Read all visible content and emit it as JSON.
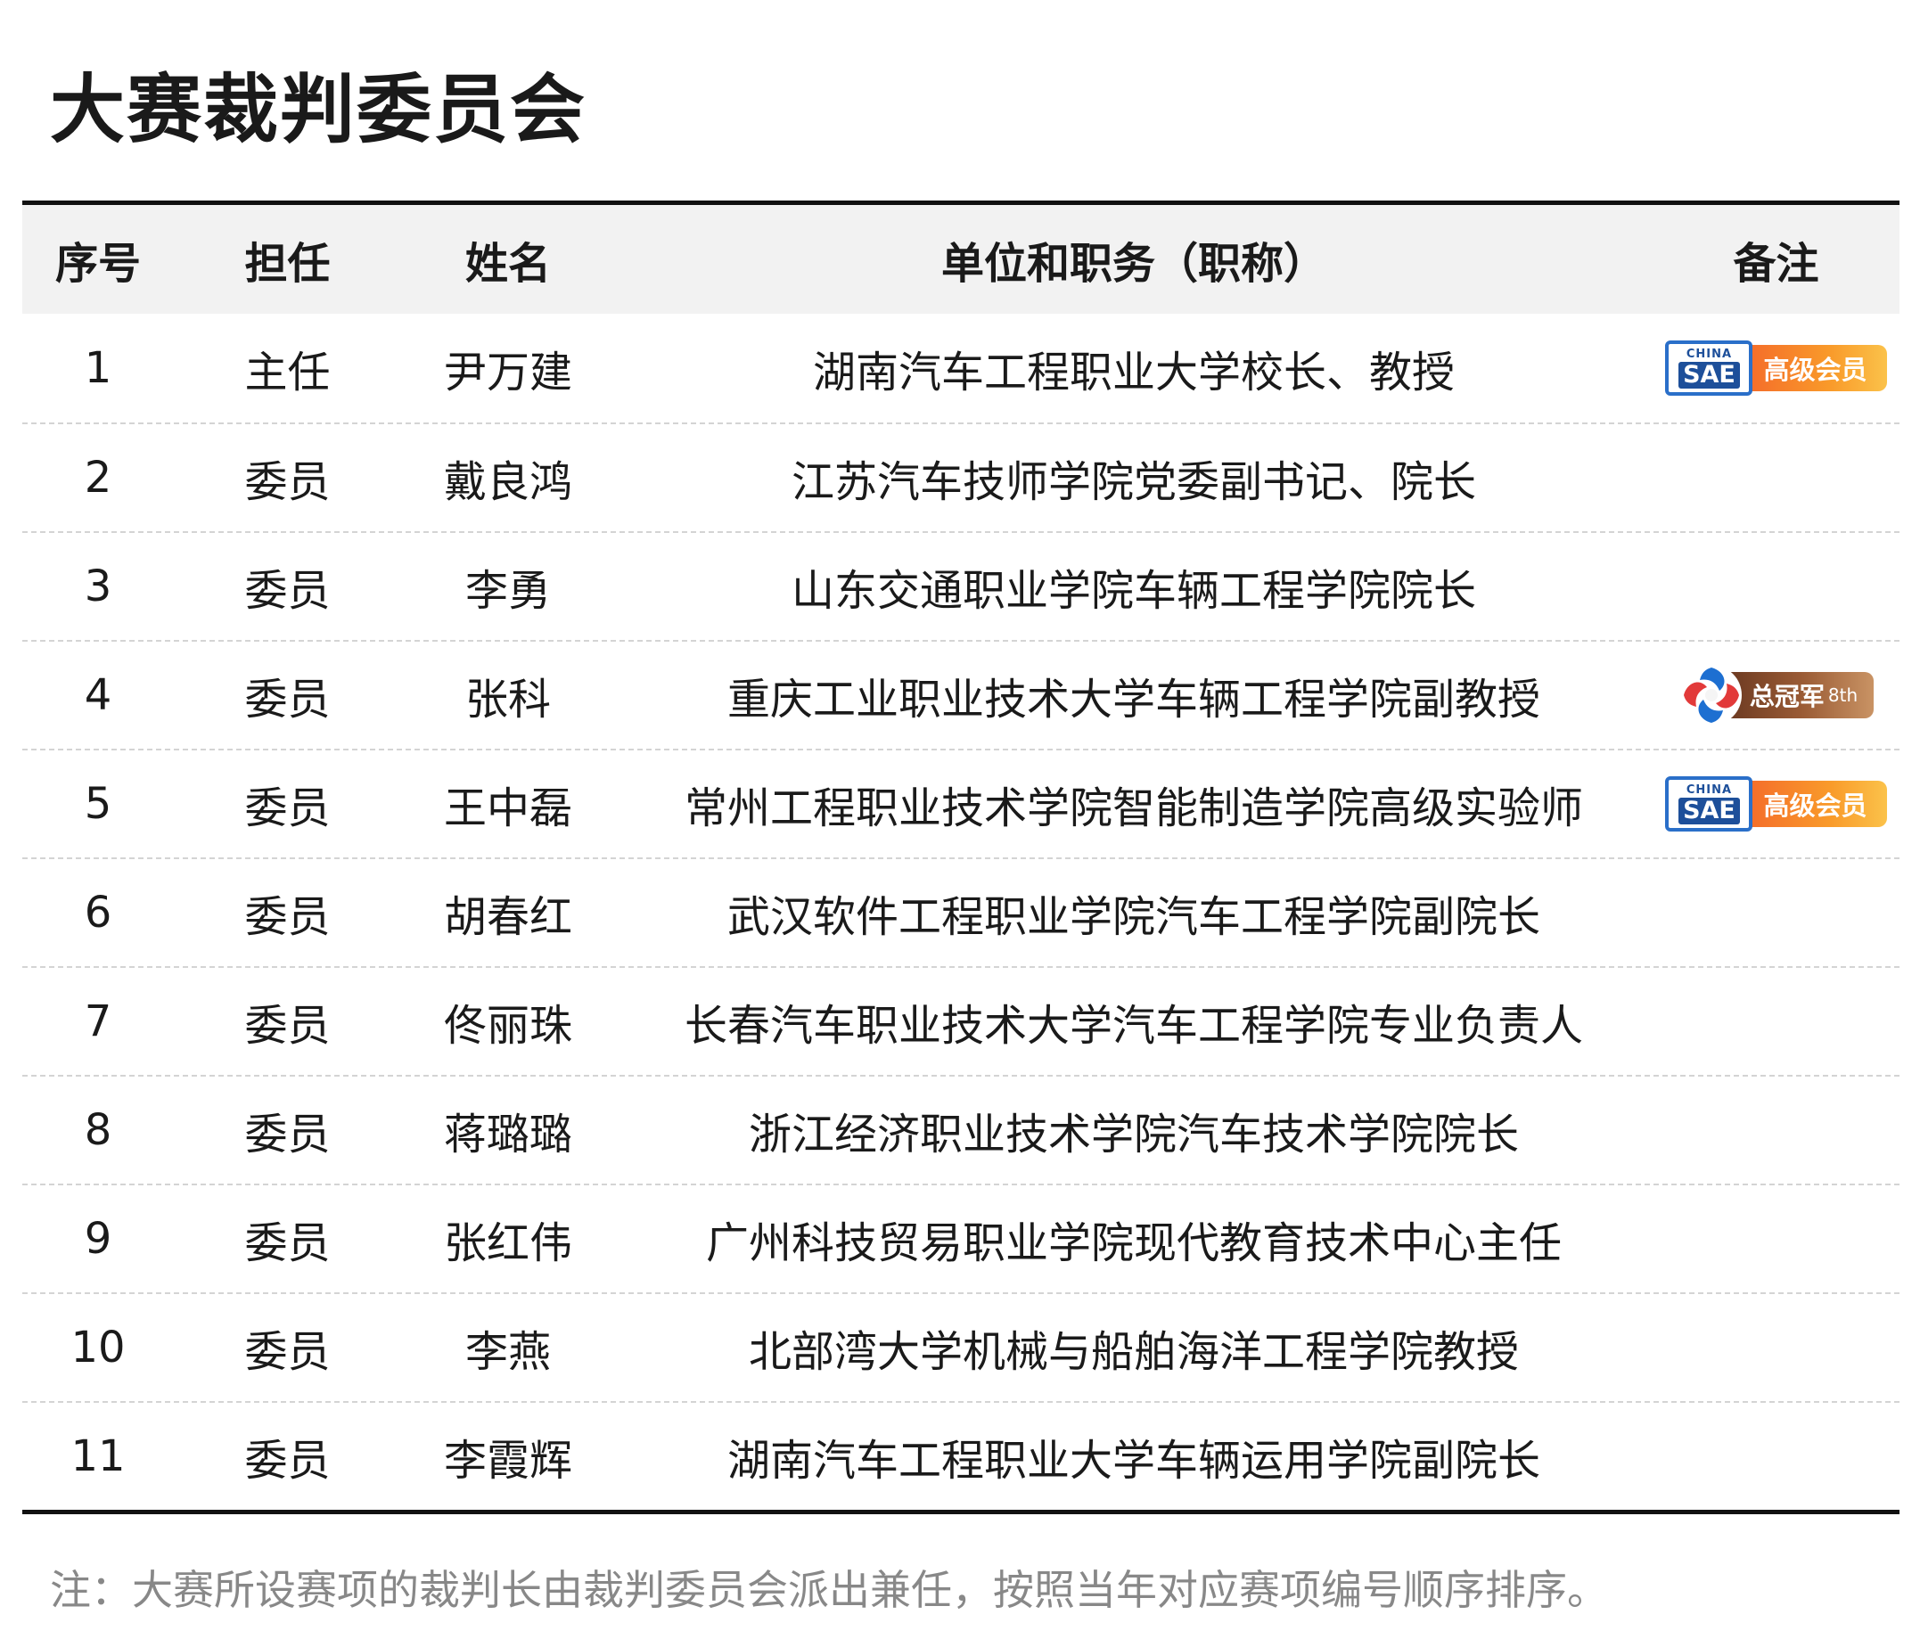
{
  "title": "大赛裁判委员会",
  "table": {
    "headers": [
      "序号",
      "担任",
      "姓名",
      "单位和职务（职称）",
      "备注"
    ],
    "rows": [
      {
        "no": "1",
        "role": "主任",
        "name": "尹万建",
        "unit": "湖南汽车工程职业大学校长、教授",
        "badge": "sae"
      },
      {
        "no": "2",
        "role": "委员",
        "name": "戴良鸿",
        "unit": "江苏汽车技师学院党委副书记、院长",
        "badge": ""
      },
      {
        "no": "3",
        "role": "委员",
        "name": "李勇",
        "unit": "山东交通职业学院车辆工程学院院长",
        "badge": ""
      },
      {
        "no": "4",
        "role": "委员",
        "name": "张科",
        "unit": "重庆工业职业技术大学车辆工程学院副教授",
        "badge": "champion"
      },
      {
        "no": "5",
        "role": "委员",
        "name": "王中磊",
        "unit": "常州工程职业技术学院智能制造学院高级实验师",
        "badge": "sae"
      },
      {
        "no": "6",
        "role": "委员",
        "name": "胡春红",
        "unit": "武汉软件工程职业学院汽车工程学院副院长",
        "badge": ""
      },
      {
        "no": "7",
        "role": "委员",
        "name": "佟丽珠",
        "unit": "长春汽车职业技术大学汽车工程学院专业负责人",
        "badge": ""
      },
      {
        "no": "8",
        "role": "委员",
        "name": "蒋璐璐",
        "unit": "浙江经济职业技术学院汽车技术学院院长",
        "badge": ""
      },
      {
        "no": "9",
        "role": "委员",
        "name": "张红伟",
        "unit": "广州科技贸易职业学院现代教育技术中心主任",
        "badge": ""
      },
      {
        "no": "10",
        "role": "委员",
        "name": "李燕",
        "unit": "北部湾大学机械与船舶海洋工程学院教授",
        "badge": ""
      },
      {
        "no": "11",
        "role": "委员",
        "name": "李霞辉",
        "unit": "湖南汽车工程职业大学车辆运用学院副院长",
        "badge": ""
      }
    ]
  },
  "badges": {
    "sae": {
      "logo_top": "CHINA",
      "logo_bottom": "SAE",
      "label": "高级会员",
      "icon": "china-sae-logo-icon"
    },
    "champion": {
      "label": "总冠军",
      "suffix": "8th",
      "icon": "champion-ribbon-logo-icon"
    }
  },
  "footnote": "注：大赛所设赛项的裁判长由裁判委员会派出兼任，按照当年对应赛项编号顺序排序。"
}
